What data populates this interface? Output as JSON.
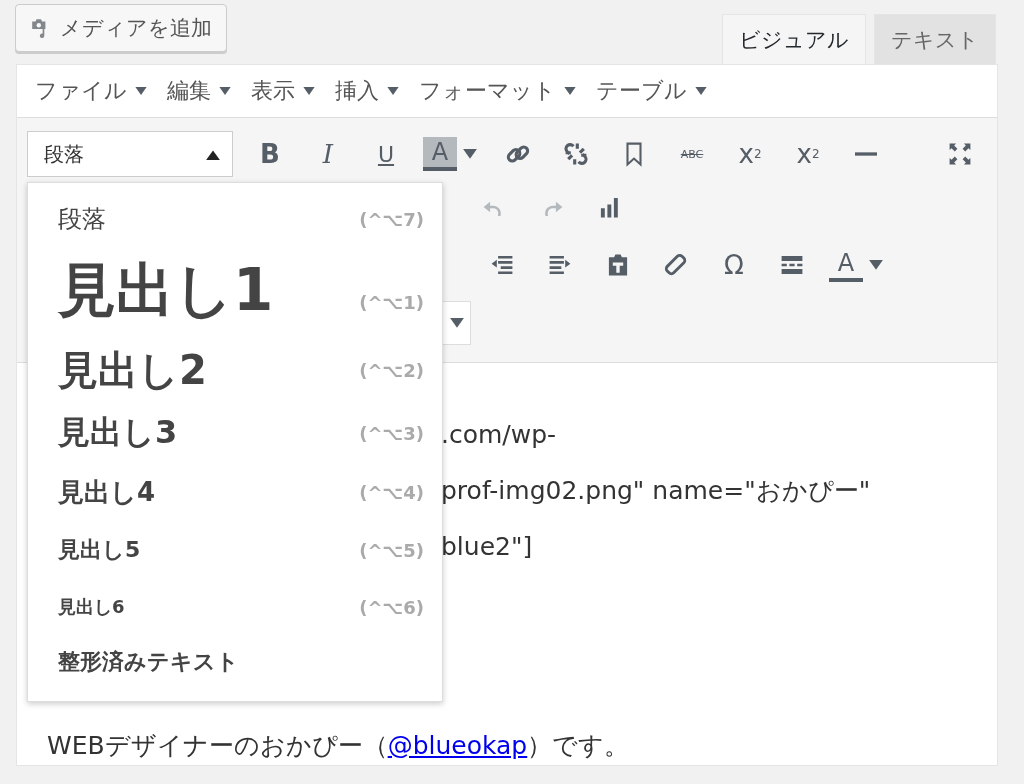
{
  "media_button": {
    "label": "メディアを追加"
  },
  "tabs": [
    {
      "label": "ビジュアル",
      "selected": true
    },
    {
      "label": "テキスト",
      "selected": false
    }
  ],
  "menubar": [
    "ファイル",
    "編集",
    "表示",
    "挿入",
    "フォーマット",
    "テーブル"
  ],
  "format_select": {
    "value": "段落",
    "expanded": true
  },
  "toolbar_rows": [
    [
      {
        "kind": "bold",
        "glyph": "B"
      },
      {
        "kind": "italic",
        "glyph": "I"
      },
      {
        "kind": "underline",
        "glyph": "U"
      },
      {
        "kind": "backcolor",
        "glyph": "A"
      },
      {
        "kind": "caret"
      },
      {
        "kind": "link"
      },
      {
        "kind": "unlink"
      },
      {
        "kind": "bookmark"
      },
      {
        "kind": "strike",
        "glyph": "ABC"
      },
      {
        "kind": "sub",
        "glyph": "x",
        "index": "2"
      },
      {
        "kind": "sup",
        "glyph": "x",
        "index": "2"
      },
      {
        "kind": "hr"
      },
      {
        "kind": "spacer"
      },
      {
        "kind": "fullscreen"
      }
    ],
    [
      {
        "kind": "undo",
        "disabled": true
      },
      {
        "kind": "redo",
        "disabled": true
      },
      {
        "kind": "chart"
      }
    ],
    [
      {
        "kind": "outdent"
      },
      {
        "kind": "indent"
      },
      {
        "kind": "paste"
      },
      {
        "kind": "eraser"
      },
      {
        "kind": "omega",
        "glyph": "Ω"
      },
      {
        "kind": "more"
      },
      {
        "kind": "forecolor",
        "glyph": "A"
      },
      {
        "kind": "caret"
      }
    ],
    [
      {
        "kind": "select"
      }
    ]
  ],
  "format_menu": [
    {
      "label": "段落",
      "shortcut": "(^⌥7)",
      "kind": "p"
    },
    {
      "label": "見出し1",
      "shortcut": "(^⌥1)",
      "kind": "h1"
    },
    {
      "label": "見出し2",
      "shortcut": "(^⌥2)",
      "kind": "h2"
    },
    {
      "label": "見出し3",
      "shortcut": "(^⌥3)",
      "kind": "h3"
    },
    {
      "label": "見出し4",
      "shortcut": "(^⌥4)",
      "kind": "h4"
    },
    {
      "label": "見出し5",
      "shortcut": "(^⌥5)",
      "kind": "h5"
    },
    {
      "label": "見出し6",
      "shortcut": "(^⌥6)",
      "kind": "h6"
    },
    {
      "label": "整形済みテキスト",
      "kind": "pre"
    }
  ],
  "content": {
    "lines": [
      ".com/wp-",
      "prof-img02.png\" name=\"おかぴー\"",
      "blue2\"]"
    ],
    "paragraph": [
      {
        "text": "WEBデザイナーのおかぴー（"
      },
      {
        "text": "@blueokap",
        "link": true
      },
      {
        "text": "）です。"
      }
    ]
  }
}
